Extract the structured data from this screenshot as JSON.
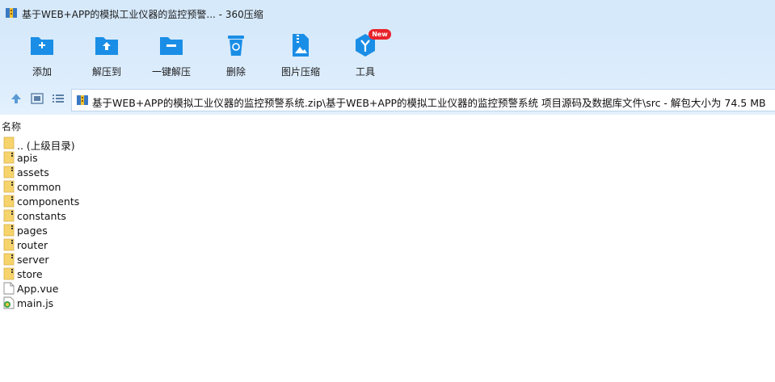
{
  "window": {
    "title": "基于WEB+APP的模拟工业仪器的监控预警... - 360压缩"
  },
  "toolbar": {
    "items": [
      {
        "label": "添加",
        "icon": "add-icon"
      },
      {
        "label": "解压到",
        "icon": "extract-to-icon"
      },
      {
        "label": "一键解压",
        "icon": "one-click-extract-icon"
      },
      {
        "label": "删除",
        "icon": "delete-icon"
      },
      {
        "label": "图片压缩",
        "icon": "image-compress-icon"
      },
      {
        "label": "工具",
        "icon": "tools-icon",
        "badge": "New"
      }
    ]
  },
  "nav": {
    "path": "基于WEB+APP的模拟工业仪器的监控预警系统.zip\\基于WEB+APP的模拟工业仪器的监控预警系统 项目源码及数据库文件\\src - 解包大小为 74.5 MB"
  },
  "list": {
    "header": "名称",
    "items": [
      {
        "name": ".. (上级目录)",
        "type": "parent"
      },
      {
        "name": "apis",
        "type": "folder"
      },
      {
        "name": "assets",
        "type": "folder"
      },
      {
        "name": "common",
        "type": "folder"
      },
      {
        "name": "components",
        "type": "folder"
      },
      {
        "name": "constants",
        "type": "folder"
      },
      {
        "name": "pages",
        "type": "folder"
      },
      {
        "name": "router",
        "type": "folder"
      },
      {
        "name": "server",
        "type": "folder"
      },
      {
        "name": "store",
        "type": "folder"
      },
      {
        "name": "App.vue",
        "type": "file"
      },
      {
        "name": "main.js",
        "type": "js"
      }
    ]
  },
  "colors": {
    "accent": "#1a8ee6",
    "folder": "#f6d36b",
    "badge": "#e8232a",
    "toolbar_bg": "#d6e9fb"
  }
}
